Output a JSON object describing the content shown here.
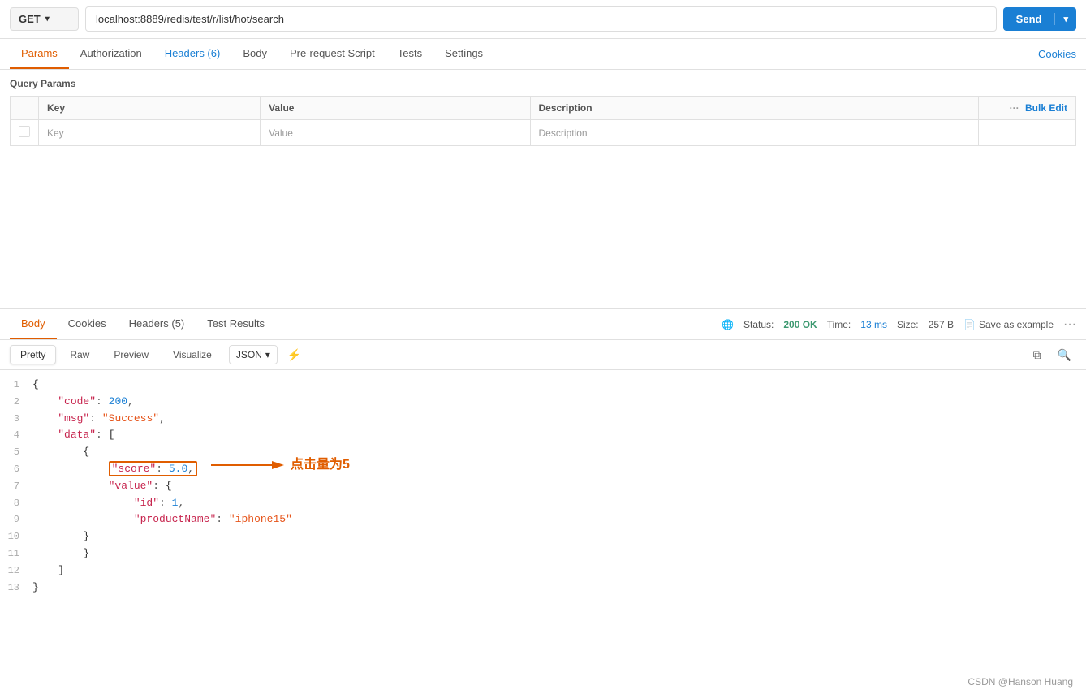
{
  "url_bar": {
    "method": "GET",
    "url": "localhost:8889/redis/test/r/list/hot/search",
    "send_label": "Send"
  },
  "tabs": {
    "items": [
      {
        "label": "Params",
        "active": true
      },
      {
        "label": "Authorization",
        "active": false
      },
      {
        "label": "Headers (6)",
        "active": false,
        "blue": true
      },
      {
        "label": "Body",
        "active": false
      },
      {
        "label": "Pre-request Script",
        "active": false
      },
      {
        "label": "Tests",
        "active": false
      },
      {
        "label": "Settings",
        "active": false
      }
    ],
    "cookies_label": "Cookies"
  },
  "query_params": {
    "title": "Query Params",
    "columns": [
      "Key",
      "Value",
      "Description"
    ],
    "bulk_edit": "Bulk Edit",
    "placeholder_key": "Key",
    "placeholder_value": "Value",
    "placeholder_desc": "Description"
  },
  "response": {
    "tabs": [
      {
        "label": "Body",
        "active": true
      },
      {
        "label": "Cookies",
        "active": false
      },
      {
        "label": "Headers (5)",
        "active": false
      },
      {
        "label": "Test Results",
        "active": false
      }
    ],
    "status_label": "Status:",
    "status_value": "200 OK",
    "time_label": "Time:",
    "time_value": "13 ms",
    "size_label": "Size:",
    "size_value": "257 B",
    "save_example": "Save as example"
  },
  "format_toolbar": {
    "views": [
      "Pretty",
      "Raw",
      "Preview",
      "Visualize"
    ],
    "active_view": "Pretty",
    "format": "JSON",
    "filter_icon": "≡"
  },
  "code": {
    "lines": [
      {
        "num": 1,
        "content": "{"
      },
      {
        "num": 2,
        "content": "    \"code\": 200,"
      },
      {
        "num": 3,
        "content": "    \"msg\": \"Success\","
      },
      {
        "num": 4,
        "content": "    \"data\": ["
      },
      {
        "num": 5,
        "content": "        {"
      },
      {
        "num": 6,
        "content": "            \"score\": 5.0,",
        "highlight": true
      },
      {
        "num": 7,
        "content": "            \"value\": {"
      },
      {
        "num": 8,
        "content": "                \"id\": 1,"
      },
      {
        "num": 9,
        "content": "                \"productName\": \"iphone15\""
      },
      {
        "num": 10,
        "content": "        }"
      },
      {
        "num": 11,
        "content": "        }"
      },
      {
        "num": 12,
        "content": "    ]"
      },
      {
        "num": 13,
        "content": "}"
      }
    ],
    "annotation_text": "点击量为5"
  },
  "footer": {
    "text": "CSDN @Hanson Huang"
  }
}
